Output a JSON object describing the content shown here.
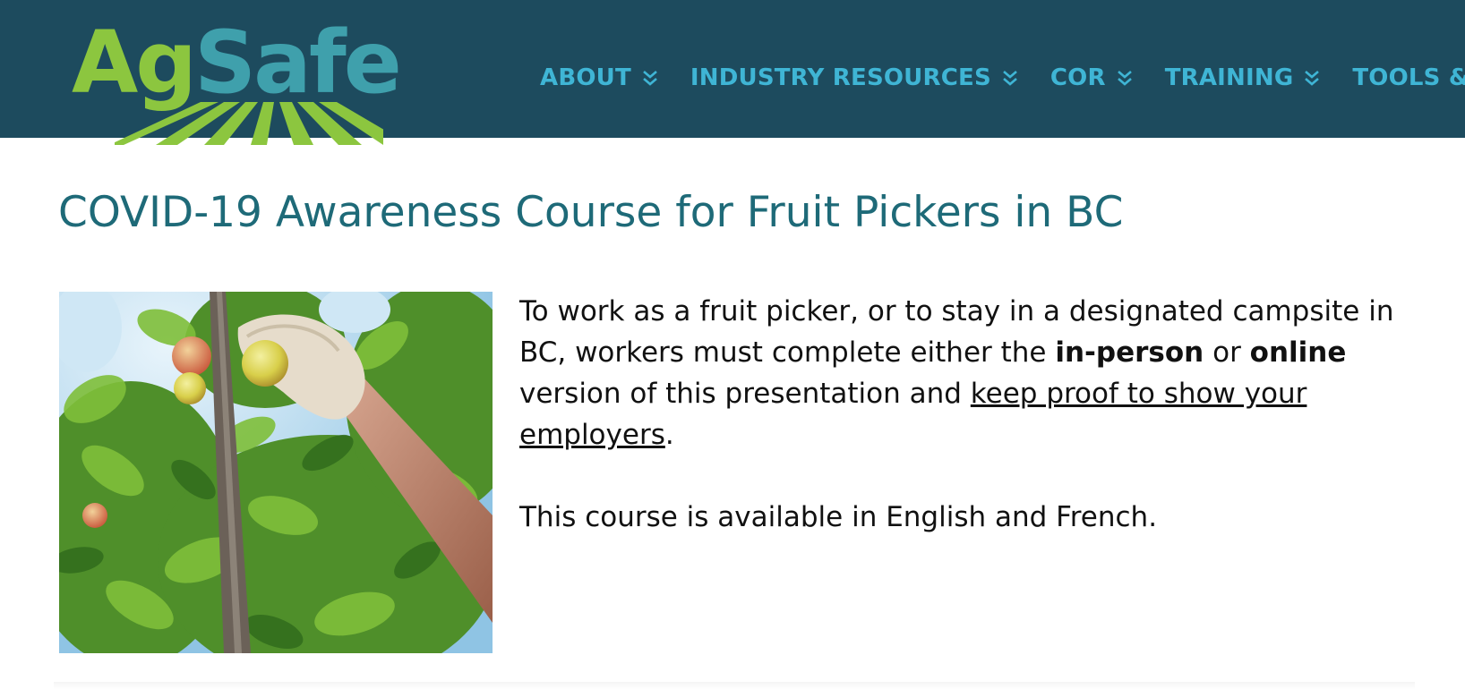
{
  "header": {
    "logo_text": "AgSafe",
    "logo_part1": "Ag",
    "logo_part2": "Safe",
    "nav": [
      {
        "label": "ABOUT",
        "icon": "double-chevron-down-icon"
      },
      {
        "label": "INDUSTRY RESOURCES",
        "icon": "double-chevron-down-icon"
      },
      {
        "label": "COR",
        "icon": "double-chevron-down-icon"
      },
      {
        "label": "TRAINING",
        "icon": "double-chevron-down-icon"
      },
      {
        "label": "TOOLS & I",
        "icon": "double-chevron-down-icon"
      }
    ]
  },
  "page": {
    "title": "COVID-19 Awareness Course for Fruit Pickers in BC",
    "paragraph1": {
      "part1": "To work as a fruit picker, or to stay in a designated campsite in BC, workers must complete either the ",
      "bold1": "in-person",
      "part2": " or ",
      "bold2": "online",
      "part3": " version of this presentation and ",
      "link": "keep proof to show your employers",
      "part4": "."
    },
    "paragraph2": "This course is available in English and French."
  },
  "colors": {
    "header_bg": "#1d4b5e",
    "nav_text": "#3fb5d5",
    "title": "#1e6a78",
    "logo_green": "#8cc63f",
    "logo_teal": "#3fa0ac"
  }
}
